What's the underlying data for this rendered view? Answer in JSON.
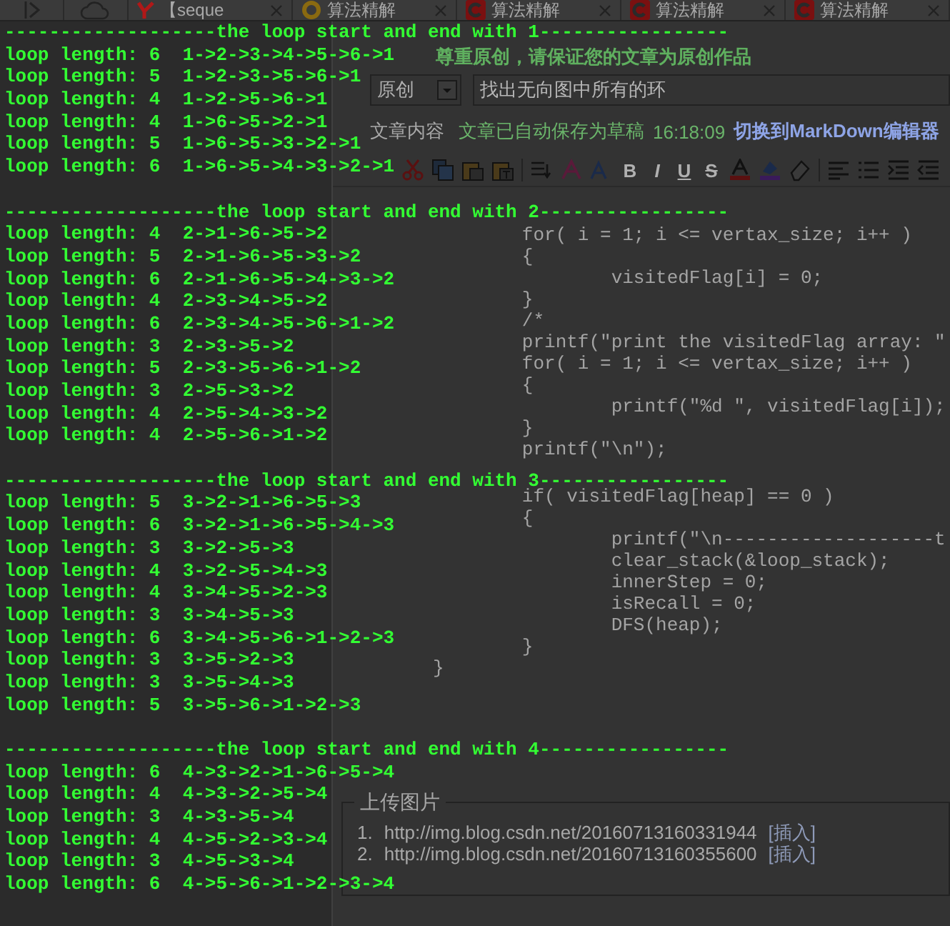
{
  "browser": {
    "tabs": [
      {
        "label": "【seque",
        "kind": "letter"
      },
      {
        "label": "算法精解",
        "kind": "round"
      },
      {
        "label": "算法精解",
        "kind": "square"
      },
      {
        "label": "算法精解",
        "kind": "square"
      },
      {
        "label": "算法精解",
        "kind": "square"
      }
    ]
  },
  "editor": {
    "notice": "尊重原创，请保证您的文章为原创作品",
    "article_type": "原创",
    "title_value": "找出无向图中所有的环",
    "content_label": "文章内容",
    "autosave": "文章已自动保存为草稿",
    "time": "16:18:09",
    "switch_link": "切换到MarkDown编辑器",
    "format_buttons": [
      "B",
      "I",
      "U",
      "S"
    ],
    "code_blocks": [
      [
        "        for( i = 1; i <= vertax_size; i++ )",
        "        {",
        "                visitedFlag[i] = 0;",
        "        }",
        "        /*",
        "        printf(\"print the visitedFlag array: \"",
        "        for( i = 1; i <= vertax_size; i++ )",
        "        {",
        "                printf(\"%d \", visitedFlag[i]);",
        "        }",
        "        printf(\"\\n\");"
      ],
      [
        "        if( visitedFlag[heap] == 0 )",
        "        {",
        "                printf(\"\\n-------------------t",
        "                clear_stack(&loop_stack);",
        "                innerStep = 0;",
        "                isRecall = 0;",
        "                DFS(heap);",
        "        }",
        "}"
      ]
    ]
  },
  "upload": {
    "legend": "上传图片",
    "images": [
      {
        "number": "1.",
        "url": "http://img.blog.csdn.net/20160713160331944",
        "action": "[插入]"
      },
      {
        "number": "2.",
        "url": "http://img.blog.csdn.net/20160713160355600",
        "action": "[插入]"
      }
    ]
  },
  "console": {
    "sections": [
      {
        "heading": "-------------------the loop start and end with 1-----------------",
        "lines": [
          "loop length: 6  1->2->3->4->5->6->1",
          "loop length: 5  1->2->3->5->6->1",
          "loop length: 4  1->2->5->6->1",
          "loop length: 4  1->6->5->2->1",
          "loop length: 5  1->6->5->3->2->1",
          "loop length: 6  1->6->5->4->3->2->1"
        ]
      },
      {
        "heading": "-------------------the loop start and end with 2-----------------",
        "lines": [
          "loop length: 4  2->1->6->5->2",
          "loop length: 5  2->1->6->5->3->2",
          "loop length: 6  2->1->6->5->4->3->2",
          "loop length: 4  2->3->4->5->2",
          "loop length: 6  2->3->4->5->6->1->2",
          "loop length: 3  2->3->5->2",
          "loop length: 5  2->3->5->6->1->2",
          "loop length: 3  2->5->3->2",
          "loop length: 4  2->5->4->3->2",
          "loop length: 4  2->5->6->1->2"
        ]
      },
      {
        "heading": "-------------------the loop start and end with 3-----------------",
        "lines": [
          "loop length: 5  3->2->1->6->5->3",
          "loop length: 6  3->2->1->6->5->4->3",
          "loop length: 3  3->2->5->3",
          "loop length: 4  3->2->5->4->3",
          "loop length: 4  3->4->5->2->3",
          "loop length: 3  3->4->5->3",
          "loop length: 6  3->4->5->6->1->2->3",
          "loop length: 3  3->5->2->3",
          "loop length: 3  3->5->4->3",
          "loop length: 5  3->5->6->1->2->3"
        ]
      },
      {
        "heading": "-------------------the loop start and end with 4-----------------",
        "lines": [
          "loop length: 6  4->3->2->1->6->5->4",
          "loop length: 4  4->3->2->5->4",
          "loop length: 3  4->3->5->4",
          "loop length: 4  4->5->2->3->4",
          "loop length: 3  4->5->3->4",
          "loop length: 6  4->5->6->1->2->3->4"
        ]
      }
    ]
  }
}
